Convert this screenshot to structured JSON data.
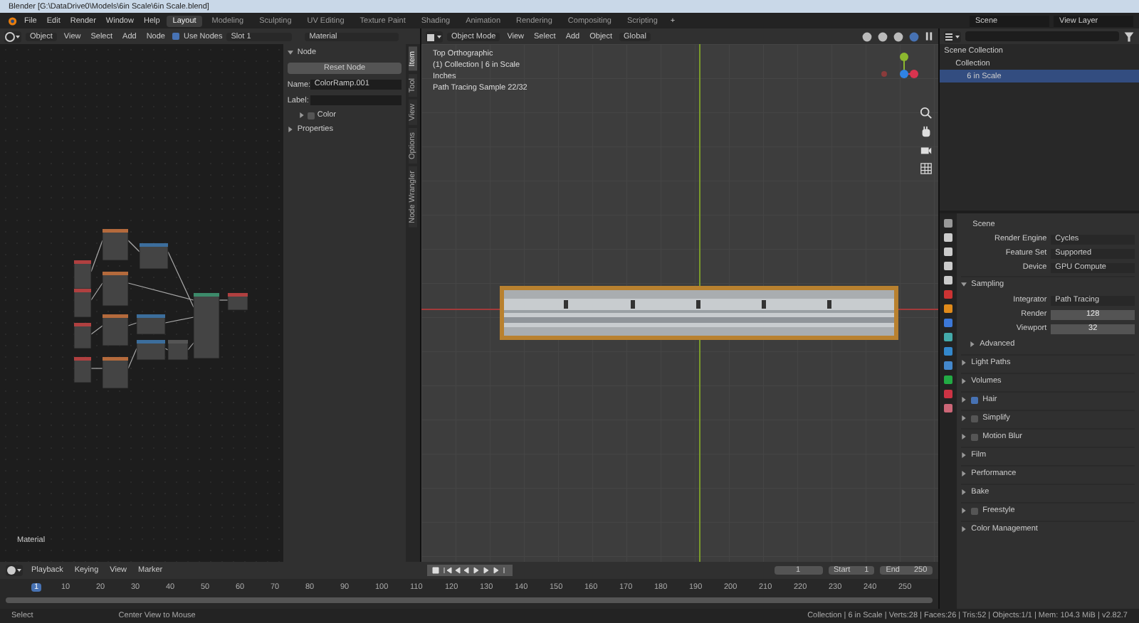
{
  "window": {
    "title": "Blender [G:\\DataDrive0\\Models\\6in Scale\\6in Scale.blend]"
  },
  "menu": [
    "File",
    "Edit",
    "Render",
    "Window",
    "Help"
  ],
  "workspaces": [
    {
      "label": "Layout",
      "selected": true
    },
    {
      "label": "Modeling",
      "selected": false
    },
    {
      "label": "Sculpting",
      "selected": false
    },
    {
      "label": "UV Editing",
      "selected": false
    },
    {
      "label": "Texture Paint",
      "selected": false
    },
    {
      "label": "Shading",
      "selected": false
    },
    {
      "label": "Animation",
      "selected": false
    },
    {
      "label": "Rendering",
      "selected": false
    },
    {
      "label": "Compositing",
      "selected": false
    },
    {
      "label": "Scripting",
      "selected": false
    }
  ],
  "add_workspace": "+",
  "scene": "Scene",
  "view_layer": "View Layer",
  "node_editor": {
    "mode": "Object",
    "menus": [
      "View",
      "Select",
      "Add",
      "Node"
    ],
    "use_nodes": {
      "label": "Use Nodes",
      "checked": true
    },
    "slot": "Slot 1",
    "material": "Material",
    "footer": "Material"
  },
  "sidebar": {
    "panel": {
      "label": "Node",
      "expanded": true
    },
    "reset": "Reset Node",
    "name_label": "Name:",
    "name": "ColorRamp.001",
    "label_label": "Label:",
    "color": {
      "label": "Color",
      "checked": false,
      "expanded": false
    },
    "properties": {
      "label": "Properties",
      "expanded": false
    },
    "tabs": [
      {
        "label": "Item",
        "selected": true
      },
      {
        "label": "Tool",
        "selected": false
      },
      {
        "label": "View",
        "selected": false
      },
      {
        "label": "Options",
        "selected": false
      },
      {
        "label": "Node Wrangler",
        "selected": false
      }
    ]
  },
  "viewport": {
    "mode": "Object Mode",
    "menus": [
      "View",
      "Select",
      "Add",
      "Object"
    ],
    "orientation": "Global",
    "overlay": [
      "Top Orthographic",
      "(1) Collection | 6 in Scale",
      "Inches",
      "Path Tracing Sample 22/32"
    ]
  },
  "outliner": {
    "tree": [
      {
        "label": "Scene Collection",
        "selected": false,
        "children": [
          {
            "label": "Collection",
            "selected": false,
            "children": [
              {
                "label": "6 in Scale",
                "selected": true
              }
            ]
          }
        ]
      }
    ]
  },
  "properties": {
    "scene": "Scene",
    "fields": [
      {
        "label": "Render Engine",
        "value": "Cycles"
      },
      {
        "label": "Feature Set",
        "value": "Supported"
      },
      {
        "label": "Device",
        "value": "GPU Compute"
      }
    ],
    "sampling": {
      "label": "Sampling",
      "expanded": true,
      "integrator": {
        "label": "Integrator",
        "value": "Path Tracing"
      },
      "numbers": [
        {
          "label": "Render",
          "value": "128"
        },
        {
          "label": "Viewport",
          "value": "32"
        }
      ],
      "advanced": {
        "label": "Advanced",
        "expanded": false
      }
    },
    "sections": [
      {
        "label": "Light Paths",
        "kind": "plain",
        "expanded": false
      },
      {
        "label": "Volumes",
        "kind": "plain",
        "expanded": false
      },
      {
        "label": "Hair",
        "kind": "checkbox",
        "checked": true,
        "expanded": false
      },
      {
        "label": "Simplify",
        "kind": "checkbox",
        "checked": false,
        "expanded": false
      },
      {
        "label": "Motion Blur",
        "kind": "checkbox",
        "checked": false,
        "expanded": false
      },
      {
        "label": "Film",
        "kind": "plain",
        "expanded": false
      },
      {
        "label": "Performance",
        "kind": "plain",
        "expanded": false
      },
      {
        "label": "Bake",
        "kind": "plain",
        "expanded": false
      },
      {
        "label": "Freestyle",
        "kind": "checkbox",
        "checked": false,
        "expanded": false
      },
      {
        "label": "Color Management",
        "kind": "plain",
        "expanded": false
      }
    ]
  },
  "timeline": {
    "menus": [
      "Playback",
      "Keying",
      "View",
      "Marker"
    ],
    "frame": "1",
    "start_label": "Start",
    "start": "1",
    "end_label": "End",
    "end": "250",
    "playhead": "1",
    "ticks": [
      "10",
      "20",
      "30",
      "40",
      "50",
      "60",
      "70",
      "80",
      "90",
      "100",
      "110",
      "120",
      "130",
      "140",
      "150",
      "160",
      "170",
      "180",
      "190",
      "200",
      "210",
      "220",
      "230",
      "240",
      "250"
    ]
  },
  "status_bar": {
    "hints": [
      "Select",
      "Center View to Mouse"
    ],
    "stats": "Collection | 6 in Scale | Verts:28 | Faces:26 | Tris:52 | Objects:1/1 | Mem: 104.3 MiB | v2.82.7"
  }
}
